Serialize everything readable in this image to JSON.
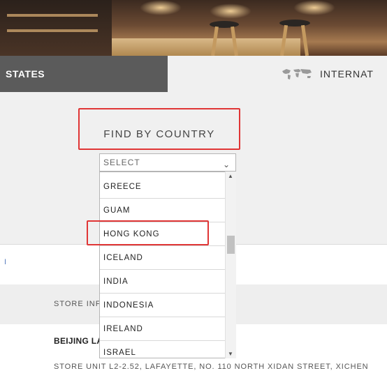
{
  "tabs": {
    "states_label": "STATES",
    "international_label": "INTERNAT",
    "international_icon": "world-map-icon"
  },
  "find": {
    "title": "FIND BY COUNTRY",
    "select_value": "SELECT",
    "select_icon": "chevron-down-icon",
    "options": [
      "GREECE",
      "GUAM",
      "HONG KONG",
      "ICELAND",
      "INDIA",
      "INDONESIA",
      "IRELAND",
      "ISRAEL"
    ],
    "highlighted_option": "HONG KONG"
  },
  "store": {
    "left_marker": "I",
    "info_label": "STORE INF",
    "name": "BEIJING LA",
    "address": "STORE UNIT L2-2.52, LAFAYETTE, NO. 110 NORTH XIDAN STREET, XICHEN"
  },
  "colors": {
    "tab_active_bg": "#5b5b5b",
    "highlight_red": "#e03535",
    "panel_bg": "#f0f0f0"
  }
}
